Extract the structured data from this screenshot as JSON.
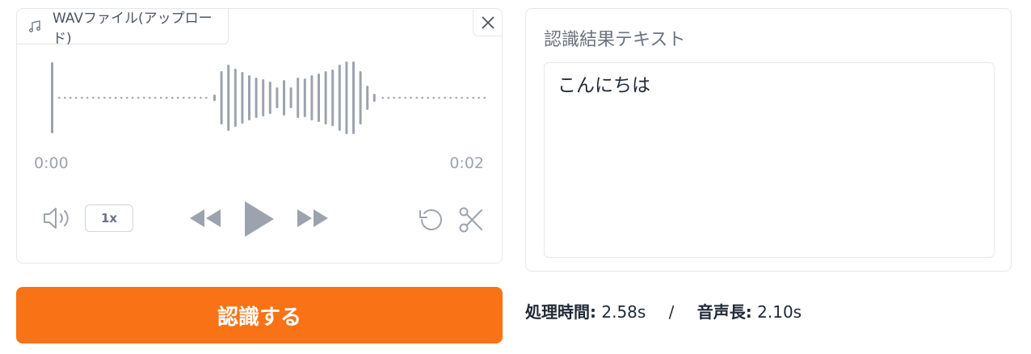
{
  "audio": {
    "file_label": "WAVファイル(アップロード)",
    "time_start": "0:00",
    "time_end": "0:02",
    "speed": "1x",
    "icons": {
      "music": "music-note-icon",
      "close": "close-icon",
      "volume": "volume-icon",
      "rewind": "rewind-icon",
      "play": "play-icon",
      "forward": "fast-forward-icon",
      "reset": "undo-icon",
      "trim": "scissors-icon"
    }
  },
  "result": {
    "title": "認識結果テキスト",
    "text": "こんにちは"
  },
  "action": {
    "recognize_label": "認識する"
  },
  "stats": {
    "processing_label": "処理時間:",
    "processing_value": "2.58s",
    "separator": "/",
    "duration_label": "音声長:",
    "duration_value": "2.10s"
  },
  "colors": {
    "accent": "#f97316",
    "waveform": "#9ca3af",
    "border": "#e5e7eb"
  }
}
